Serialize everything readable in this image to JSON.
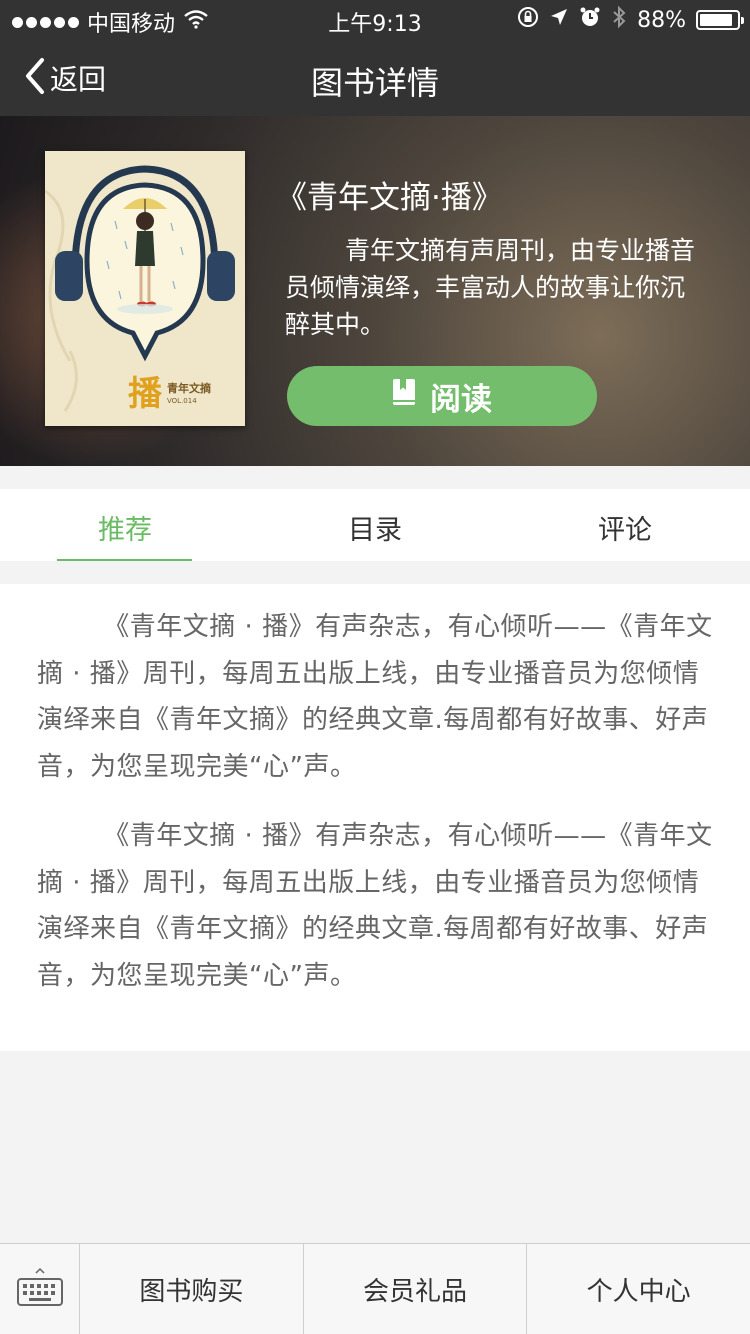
{
  "status_bar": {
    "carrier": "中国移动",
    "time": "上午9:13",
    "battery_pct": "88%",
    "battery_level": 0.88,
    "icons": [
      "signal-dots-icon",
      "wifi-icon",
      "orientation-lock-icon",
      "location-icon",
      "alarm-icon",
      "bluetooth-icon",
      "battery-icon"
    ]
  },
  "nav": {
    "back_label": "返回",
    "title": "图书详情"
  },
  "hero": {
    "book_title": "《青年文摘·播》",
    "description": "青年文摘有声周刊，由专业播音员倾情演绎，丰富动人的故事让你沉醉其中。",
    "read_button": "阅读",
    "cover": {
      "main_char": "播",
      "brand": "青年文摘",
      "sub": "VOL.014"
    }
  },
  "tabs": [
    {
      "label": "推荐",
      "active": true
    },
    {
      "label": "目录",
      "active": false
    },
    {
      "label": "评论",
      "active": false
    }
  ],
  "content": {
    "paragraphs": [
      "《青年文摘 · 播》有声杂志，有心倾听——《青年文摘 · 播》周刊，每周五出版上线，由专业播音员为您倾情演绎来自《青年文摘》的经典文章.每周都有好故事、好声音，为您呈现完美“心”声。",
      "《青年文摘 · 播》有声杂志，有心倾听——《青年文摘 · 播》周刊，每周五出版上线，由专业播音员为您倾情演绎来自《青年文摘》的经典文章.每周都有好故事、好声音，为您呈现完美“心”声。"
    ]
  },
  "bottom_menu": [
    {
      "label": "图书购买"
    },
    {
      "label": "会员礼品"
    },
    {
      "label": "个人中心"
    }
  ],
  "colors": {
    "accent": "#6abb63",
    "button": "#73bd6c",
    "bar_bg": "#333333",
    "body_text": "#666666"
  }
}
